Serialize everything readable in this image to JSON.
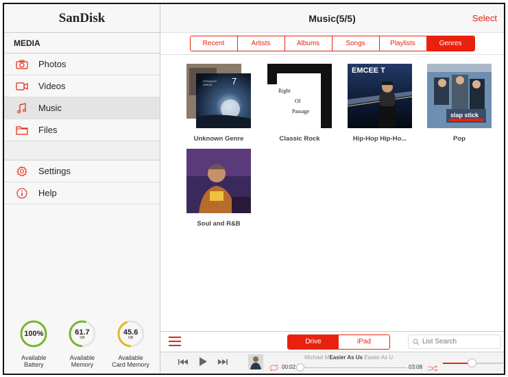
{
  "brand": "SanDisk",
  "sidebar": {
    "section_title": "MEDIA",
    "items": [
      {
        "label": "Photos",
        "icon": "camera-icon"
      },
      {
        "label": "Videos",
        "icon": "video-camera-icon"
      },
      {
        "label": "Music",
        "icon": "music-note-icon",
        "active": true
      },
      {
        "label": "Files",
        "icon": "folder-icon"
      }
    ],
    "secondary_items": [
      {
        "label": "Settings",
        "icon": "gear-icon"
      },
      {
        "label": "Help",
        "icon": "info-icon"
      }
    ]
  },
  "gauges": [
    {
      "value": "100%",
      "unit": "",
      "label_line1": "Available",
      "label_line2": "Battery",
      "fill": 1.0
    },
    {
      "value": "61.7",
      "unit": "GB",
      "label_line1": "Available",
      "label_line2": "Memory",
      "fill": 0.55
    },
    {
      "value": "45.6",
      "unit": "GB",
      "label_line1": "Available",
      "label_line2": "Card Memory",
      "fill": 0.45
    }
  ],
  "header": {
    "title": "Music(5/5)",
    "select_label": "Select"
  },
  "tabs": [
    {
      "label": "Recent"
    },
    {
      "label": "Artists"
    },
    {
      "label": "Albums"
    },
    {
      "label": "Songs"
    },
    {
      "label": "Playlists"
    },
    {
      "label": "Genres",
      "active": true
    }
  ],
  "genres": [
    {
      "name": "Unknown Genre",
      "art": "stacked-dark-covers"
    },
    {
      "name": "Classic Rock",
      "art": "right-of-passage",
      "art_text": [
        "Right",
        "Of",
        "Passage"
      ]
    },
    {
      "name": "Hip-Hop Hip-Ho...",
      "art": "night-city-rapper",
      "art_text": [
        "EMCEE T"
      ]
    },
    {
      "name": "Pop",
      "art": "slap-stick",
      "art_text": [
        "slap stick"
      ]
    },
    {
      "name": "Soul and R&B",
      "art": "man-portrait-purple"
    }
  ],
  "controls": {
    "device_toggle": [
      {
        "label": "Drive",
        "active": true
      },
      {
        "label": "iPad",
        "active": false
      }
    ],
    "search_placeholder": "List Search"
  },
  "player": {
    "artist_prefix": "Michael M",
    "title": "Easier As Us",
    "title_repeat": "Easier As U",
    "current_time": "00:02",
    "end_time": "03:08",
    "progress": 0.01,
    "volume": 0.48
  },
  "colors": {
    "accent": "#e8220e",
    "sidebar_bg": "#f7f7f7",
    "gauge_green": "#7ab32e",
    "gauge_yellow": "#e6b422",
    "gauge_red": "#d9261c"
  }
}
